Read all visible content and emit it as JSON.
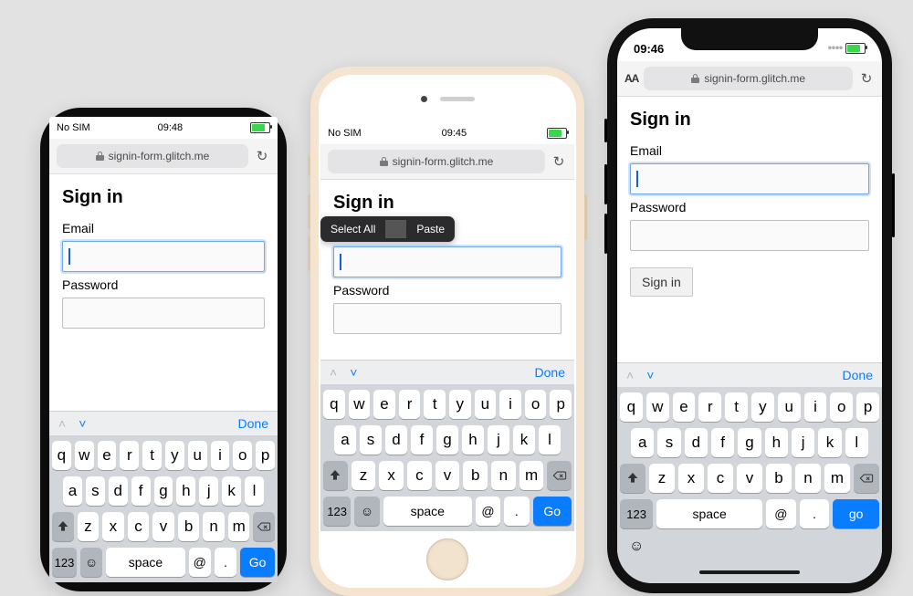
{
  "statusbar": {
    "carrier": "No SIM",
    "time_p1": "09:48",
    "time_p2": "09:45",
    "time_p3": "09:46"
  },
  "browser": {
    "url": "signin-form.glitch.me",
    "text_size_control": "AA",
    "reload_label": "↻"
  },
  "form": {
    "title": "Sign in",
    "email_label": "Email",
    "password_label": "Password",
    "submit_label": "Sign in"
  },
  "context_menu": {
    "select_all": "Select All",
    "paste": "Paste"
  },
  "keyboard": {
    "accessory": {
      "done": "Done"
    },
    "row1": [
      "q",
      "w",
      "e",
      "r",
      "t",
      "y",
      "u",
      "i",
      "o",
      "p"
    ],
    "row2": [
      "a",
      "s",
      "d",
      "f",
      "g",
      "h",
      "j",
      "k",
      "l"
    ],
    "row3": [
      "z",
      "x",
      "c",
      "v",
      "b",
      "n",
      "m"
    ],
    "numkey": "123",
    "space": "space",
    "at": "@",
    "dot": ".",
    "go": "Go",
    "go_lc": "go"
  }
}
